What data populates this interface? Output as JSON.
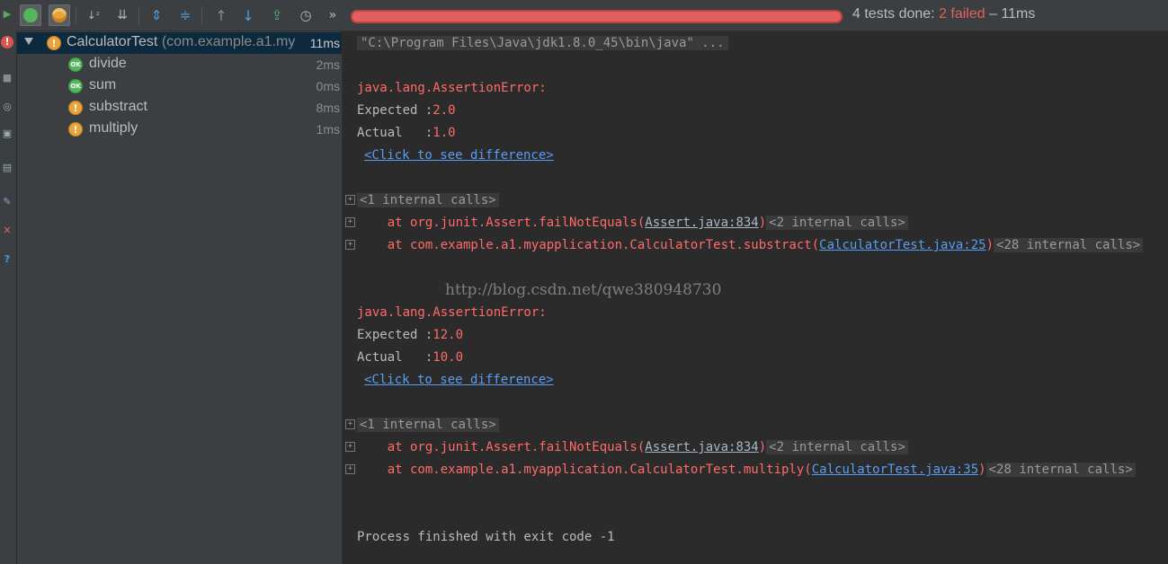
{
  "colors": {
    "accent_fail": "#e0625f",
    "ok": "#56b65d",
    "warn": "#e8a33b",
    "link": "#589df6"
  },
  "toolbar": {
    "icons": [
      "run-icon",
      "rerun-failed-icon",
      "show-passed-icon",
      "show-ignored-icon",
      "sort-alpha-icon",
      "sort-duration-icon",
      "expand-all-icon",
      "collapse-all-icon",
      "prev-failed-icon",
      "next-failed-icon",
      "export-icon",
      "history-icon",
      "more-icon"
    ],
    "more_label": "»"
  },
  "summary": {
    "done": "4 tests done: ",
    "failed": "2 failed",
    "time": " – 11ms"
  },
  "tree": {
    "root": {
      "name": "CalculatorTest",
      "package": " (com.example.a1.my",
      "time": "11ms",
      "status": "warn"
    },
    "tests": [
      {
        "name": "divide",
        "time": "2ms",
        "status": "ok"
      },
      {
        "name": "sum",
        "time": "0ms",
        "status": "ok"
      },
      {
        "name": "substract",
        "time": "8ms",
        "status": "warn"
      },
      {
        "name": "multiply",
        "time": "1ms",
        "status": "warn"
      }
    ],
    "ok_badge": "OK",
    "warn_badge": "!"
  },
  "console": {
    "command": "\"C:\\Program Files\\Java\\jdk1.8.0_45\\bin\\java\" ...",
    "failures": [
      {
        "error": "java.lang.AssertionError:",
        "expected_label": "Expected :",
        "expected": "2.0",
        "actual_label": "Actual   :",
        "actual": "1.0",
        "diff_link": "<Click to see difference>",
        "internal1": "<1 internal calls>",
        "at1_prefix": "    at org.junit.Assert.failNotEquals(",
        "at1_link": "Assert.java:834",
        "at1_suffix": ")",
        "at1_fold": "<2 internal calls>",
        "at2_prefix": "    at com.example.a1.myapplication.CalculatorTest.substract(",
        "at2_link": "CalculatorTest.java:25",
        "at2_suffix": ")",
        "at2_fold": "<28 internal calls>"
      },
      {
        "error": "java.lang.AssertionError:",
        "expected_label": "Expected :",
        "expected": "12.0",
        "actual_label": "Actual   :",
        "actual": "10.0",
        "diff_link": "<Click to see difference>",
        "internal1": "<1 internal calls>",
        "at1_prefix": "    at org.junit.Assert.failNotEquals(",
        "at1_link": "Assert.java:834",
        "at1_suffix": ")",
        "at1_fold": "<2 internal calls>",
        "at2_prefix": "    at com.example.a1.myapplication.CalculatorTest.multiply(",
        "at2_link": "CalculatorTest.java:35",
        "at2_suffix": ")",
        "at2_fold": "<28 internal calls>"
      }
    ],
    "fold_marker": "+",
    "watermark": "http://blog.csdn.net/qwe380948730",
    "exit": "Process finished with exit code -1"
  }
}
